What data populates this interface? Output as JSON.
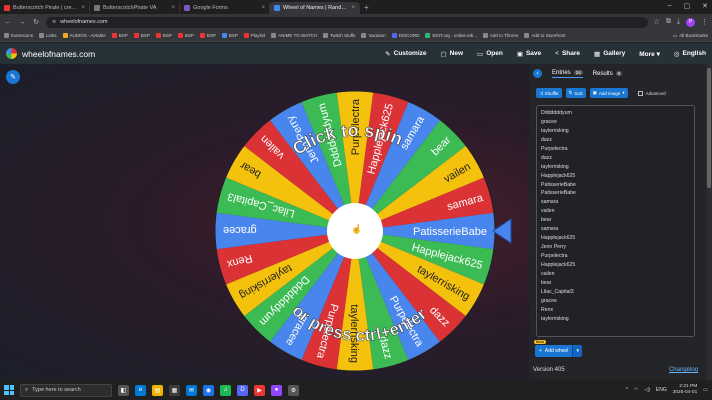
{
  "browser": {
    "tabs": [
      {
        "label": "Butterscotch Pirate | creating t",
        "color": "#e33"
      },
      {
        "label": "ButterscotchPirate VA",
        "color": "#777"
      },
      {
        "label": "Google Forms",
        "color": "#7e57c2"
      },
      {
        "label": "Wheel of Names | Random nam",
        "color": "#4885ed",
        "active": true
      }
    ],
    "new_tab": "+",
    "url": "wheelofnames.com",
    "profile_initial": "P",
    "bookmarks": [
      {
        "label": "Extensions",
        "color": "#888"
      },
      {
        "label": "Links",
        "color": "#888"
      },
      {
        "label": "AUDIOS - Airtable",
        "color": "#f5a623"
      },
      {
        "label": "BSP",
        "color": "#e33"
      },
      {
        "label": "BSP",
        "color": "#e33"
      },
      {
        "label": "BSP",
        "color": "#e33"
      },
      {
        "label": "BSP",
        "color": "#e33"
      },
      {
        "label": "BSP",
        "color": "#e33"
      },
      {
        "label": "BSP",
        "color": "#4885ed"
      },
      {
        "label": "Playlist",
        "color": "#e33"
      },
      {
        "label": "ANIME TO WATCH",
        "color": "#888"
      },
      {
        "label": "Twitch Stuffs",
        "color": "#888"
      },
      {
        "label": "Vacation",
        "color": "#888"
      },
      {
        "label": "DISCORD",
        "color": "#5865f2"
      },
      {
        "label": "EDIT.org - online edi...",
        "color": "#2bb673"
      },
      {
        "label": "Add to Throne",
        "color": "#888"
      },
      {
        "label": "Add to Storefront",
        "color": "#888"
      }
    ],
    "all_bookmarks": "All Bookmarks"
  },
  "app": {
    "brand": "wheelofnames.com",
    "menu": [
      {
        "icon": "✎",
        "label": "Customize"
      },
      {
        "icon": "▢",
        "label": "New"
      },
      {
        "icon": "▭",
        "label": "Open"
      },
      {
        "icon": "▣",
        "label": "Save"
      },
      {
        "icon": "<",
        "label": "Share"
      },
      {
        "icon": "▦",
        "label": "Gallery"
      },
      {
        "icon": "",
        "label": "More ▾"
      },
      {
        "icon": "◎",
        "label": "English"
      }
    ]
  },
  "wheel": {
    "overlay_top": "Click to spin",
    "overlay_bottom": "or press ctrl+enter",
    "colors": [
      "#4885ed",
      "#3cba54",
      "#f4c20d",
      "#db3236"
    ],
    "slices": [
      "PatisserieBabe",
      "Happlejack625",
      "taylerrisking",
      "dazz",
      "Purpelectra",
      "dazz",
      "taylerrisking",
      "Purpelectra",
      "gracee",
      "Dddddddyum",
      "taylerrisking",
      "Renx",
      "gracee",
      "Lilac_Capital3",
      "bear",
      "vailen",
      "Jenn Perry",
      "Dddddddyum",
      "Purpelectra",
      "Happlejack625",
      "samara",
      "bear",
      "vailen",
      "samara"
    ]
  },
  "sidebar": {
    "tabs": {
      "entries": "Entries",
      "entries_count": "24",
      "results": "Results",
      "results_count": "0"
    },
    "shuffle": "Shuffle",
    "sort": "Sort",
    "add_image": "Add image",
    "advanced": "Advanced",
    "entries": [
      "Dddddddyum",
      "gracee",
      "taylerrisking",
      "dazz",
      "Purpelectra",
      "dazz",
      "taylerrisking",
      "Happlejack625",
      "PatisserieBabe",
      "PatisserieBabe",
      "samara",
      "vailen",
      "bear",
      "samara",
      "Happlejack625",
      "Jenn Perry",
      "Purpelectra",
      "Happlejack625",
      "vailen",
      "bear",
      "Lilac_Capital3",
      "gracee",
      "Renx",
      "taylerrisking"
    ],
    "beta": "Beta",
    "add_wheel": "Add wheel",
    "version": "Version 405",
    "changelog": "Changelog"
  },
  "taskbar": {
    "search_placeholder": "Type here to search",
    "apps": [
      {
        "glyph": "◧",
        "color": "#555"
      },
      {
        "glyph": "e",
        "color": "#0078d4"
      },
      {
        "glyph": "▤",
        "color": "#f0b400"
      },
      {
        "glyph": "▦",
        "color": "#3d3d3d"
      },
      {
        "glyph": "✉",
        "color": "#0078d4"
      },
      {
        "glyph": "◉",
        "color": "#1a73e8"
      },
      {
        "glyph": "♫",
        "color": "#1db954"
      },
      {
        "glyph": "D",
        "color": "#5865f2"
      },
      {
        "glyph": "▶",
        "color": "#e33"
      },
      {
        "glyph": "●",
        "color": "#9146ff"
      },
      {
        "glyph": "⚙",
        "color": "#555"
      }
    ],
    "lang": "ENG",
    "time": "2:21 PM",
    "date": "2025-04-01"
  }
}
